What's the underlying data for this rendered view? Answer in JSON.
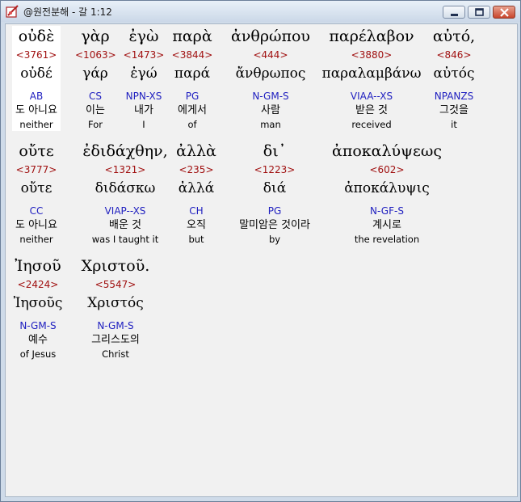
{
  "window": {
    "title": "@원전분해 - 갈 1:12",
    "minimize_label": "minimize",
    "maximize_label": "maximize",
    "close_label": "close"
  },
  "verse": {
    "rows": [
      [
        {
          "greek": "οὐδὲ",
          "strong": "<3761>",
          "lemma": "οὐδέ",
          "parse": "AB",
          "korean": "도 아니요",
          "english": "neither",
          "selected": true
        },
        {
          "greek": "γὰρ",
          "strong": "<1063>",
          "lemma": "γάρ",
          "parse": "CS",
          "korean": "이는",
          "english": "For"
        },
        {
          "greek": "ἐγὼ",
          "strong": "<1473>",
          "lemma": "ἐγώ",
          "parse": "NPN-XS",
          "korean": "내가",
          "english": "I"
        },
        {
          "greek": "παρὰ",
          "strong": "<3844>",
          "lemma": "παρά",
          "parse": "PG",
          "korean": "에게서",
          "english": "of"
        },
        {
          "greek": "ἀνθρώπου",
          "strong": "<444>",
          "lemma": "ἄνθρωπος",
          "parse": "N-GM-S",
          "korean": "사람",
          "english": "man"
        },
        {
          "greek": "παρέλαβον",
          "strong": "<3880>",
          "lemma": "παραλαμβάνω",
          "parse": "VIAA--XS",
          "korean": "받은 것",
          "english": "received"
        },
        {
          "greek": "αὐτό,",
          "strong": "<846>",
          "lemma": "αὐτός",
          "parse": "NPANZS",
          "korean": "그것을",
          "english": "it"
        }
      ],
      [
        {
          "greek": "οὔτε",
          "strong": "<3777>",
          "lemma": "οὔτε",
          "parse": "CC",
          "korean": "도 아니요",
          "english": "neither"
        },
        {
          "greek": "ἐδιδάχθην,",
          "strong": "<1321>",
          "lemma": "διδάσκω",
          "parse": "VIAP--XS",
          "korean": "배운 것",
          "english": "was I taught it"
        },
        {
          "greek": "ἀλλὰ",
          "strong": "<235>",
          "lemma": "ἀλλά",
          "parse": "CH",
          "korean": "오직",
          "english": "but"
        },
        {
          "greek": "δι᾽",
          "strong": "<1223>",
          "lemma": "διά",
          "parse": "PG",
          "korean": "말미암은 것이라",
          "english": "by"
        },
        {
          "greek": "ἀποκαλύψεως",
          "strong": "<602>",
          "lemma": "ἀποκάλυψις",
          "parse": "N-GF-S",
          "korean": "계시로",
          "english": "the revelation"
        }
      ],
      [
        {
          "greek": "Ἰησοῦ",
          "strong": "<2424>",
          "lemma": "Ἰησοῦς",
          "parse": "N-GM-S",
          "korean": "예수",
          "english": "of Jesus"
        },
        {
          "greek": "Χριστοῦ.",
          "strong": "<5547>",
          "lemma": "Χριστός",
          "parse": "N-GM-S",
          "korean": "그리스도의",
          "english": "Christ"
        }
      ]
    ]
  },
  "colors": {
    "strong_number": "#a01010",
    "parse_code": "#2020c0",
    "content_background": "#f1f1f1",
    "selected_background": "#ffffff"
  }
}
